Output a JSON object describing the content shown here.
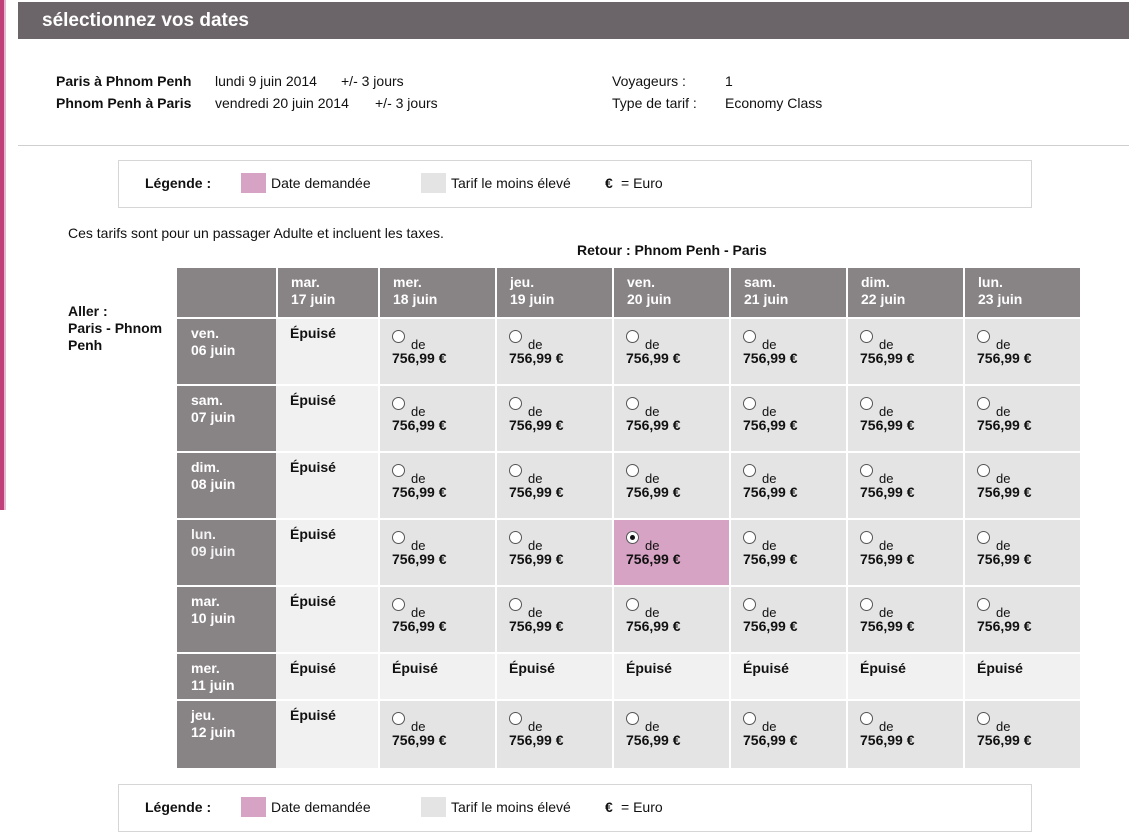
{
  "header": {
    "title": "sélectionnez vos dates"
  },
  "summary": {
    "outbound": {
      "route": "Paris à Phnom Penh",
      "date": "lundi 9 juin 2014",
      "flex": "+/- 3 jours"
    },
    "inbound": {
      "route": "Phnom Penh à Paris",
      "date": "vendredi 20 juin 2014",
      "flex": "+/- 3 jours"
    },
    "travelers_label": "Voyageurs :",
    "travelers_value": "1",
    "fare_type_label": "Type de tarif :",
    "fare_type_value": "Economy Class"
  },
  "legend": {
    "title": "Légende :",
    "requested": "Date demandée",
    "lowest": "Tarif le moins élevé",
    "currency_symbol": "€",
    "currency_text": "= Euro",
    "requested_color": "#d7a3c4",
    "lowest_color": "#e4e4e4"
  },
  "note": "Ces tarifs sont pour un passager Adulte et incluent les taxes.",
  "retour_title": "Retour : Phnom Penh - Paris",
  "aller_label": "Aller :",
  "aller_route": "Paris - Phnom Penh",
  "columns": [
    {
      "day": "mar.",
      "date": "17 juin"
    },
    {
      "day": "mer.",
      "date": "18 juin"
    },
    {
      "day": "jeu.",
      "date": "19 juin"
    },
    {
      "day": "ven.",
      "date": "20 juin"
    },
    {
      "day": "sam.",
      "date": "21 juin"
    },
    {
      "day": "dim.",
      "date": "22 juin"
    },
    {
      "day": "lun.",
      "date": "23 juin"
    }
  ],
  "rows": [
    {
      "day": "ven.",
      "date": "06 juin",
      "cells": [
        {
          "sold_out": "Épuisé"
        },
        {
          "de": "de",
          "price": "756,99 €"
        },
        {
          "de": "de",
          "price": "756,99 €"
        },
        {
          "de": "de",
          "price": "756,99 €"
        },
        {
          "de": "de",
          "price": "756,99 €"
        },
        {
          "de": "de",
          "price": "756,99 €"
        },
        {
          "de": "de",
          "price": "756,99 €"
        }
      ]
    },
    {
      "day": "sam.",
      "date": "07 juin",
      "cells": [
        {
          "sold_out": "Épuisé"
        },
        {
          "de": "de",
          "price": "756,99 €"
        },
        {
          "de": "de",
          "price": "756,99 €"
        },
        {
          "de": "de",
          "price": "756,99 €"
        },
        {
          "de": "de",
          "price": "756,99 €"
        },
        {
          "de": "de",
          "price": "756,99 €"
        },
        {
          "de": "de",
          "price": "756,99 €"
        }
      ]
    },
    {
      "day": "dim.",
      "date": "08 juin",
      "cells": [
        {
          "sold_out": "Épuisé"
        },
        {
          "de": "de",
          "price": "756,99 €"
        },
        {
          "de": "de",
          "price": "756,99 €"
        },
        {
          "de": "de",
          "price": "756,99 €"
        },
        {
          "de": "de",
          "price": "756,99 €"
        },
        {
          "de": "de",
          "price": "756,99 €"
        },
        {
          "de": "de",
          "price": "756,99 €"
        }
      ]
    },
    {
      "day": "lun.",
      "date": "09 juin",
      "cells": [
        {
          "sold_out": "Épuisé"
        },
        {
          "de": "de",
          "price": "756,99 €"
        },
        {
          "de": "de",
          "price": "756,99 €"
        },
        {
          "de": "de",
          "price": "756,99 €",
          "selected": true
        },
        {
          "de": "de",
          "price": "756,99 €"
        },
        {
          "de": "de",
          "price": "756,99 €"
        },
        {
          "de": "de",
          "price": "756,99 €"
        }
      ]
    },
    {
      "day": "mar.",
      "date": "10 juin",
      "cells": [
        {
          "sold_out": "Épuisé"
        },
        {
          "de": "de",
          "price": "756,99 €"
        },
        {
          "de": "de",
          "price": "756,99 €"
        },
        {
          "de": "de",
          "price": "756,99 €"
        },
        {
          "de": "de",
          "price": "756,99 €"
        },
        {
          "de": "de",
          "price": "756,99 €"
        },
        {
          "de": "de",
          "price": "756,99 €"
        }
      ]
    },
    {
      "day": "mer.",
      "date": "11 juin",
      "cells": [
        {
          "sold_out": "Épuisé"
        },
        {
          "sold_out": "Épuisé"
        },
        {
          "sold_out": "Épuisé"
        },
        {
          "sold_out": "Épuisé"
        },
        {
          "sold_out": "Épuisé"
        },
        {
          "sold_out": "Épuisé"
        },
        {
          "sold_out": "Épuisé"
        }
      ]
    },
    {
      "day": "jeu.",
      "date": "12 juin",
      "cells": [
        {
          "sold_out": "Épuisé"
        },
        {
          "de": "de",
          "price": "756,99 €"
        },
        {
          "de": "de",
          "price": "756,99 €"
        },
        {
          "de": "de",
          "price": "756,99 €"
        },
        {
          "de": "de",
          "price": "756,99 €"
        },
        {
          "de": "de",
          "price": "756,99 €"
        },
        {
          "de": "de",
          "price": "756,99 €"
        }
      ]
    }
  ]
}
